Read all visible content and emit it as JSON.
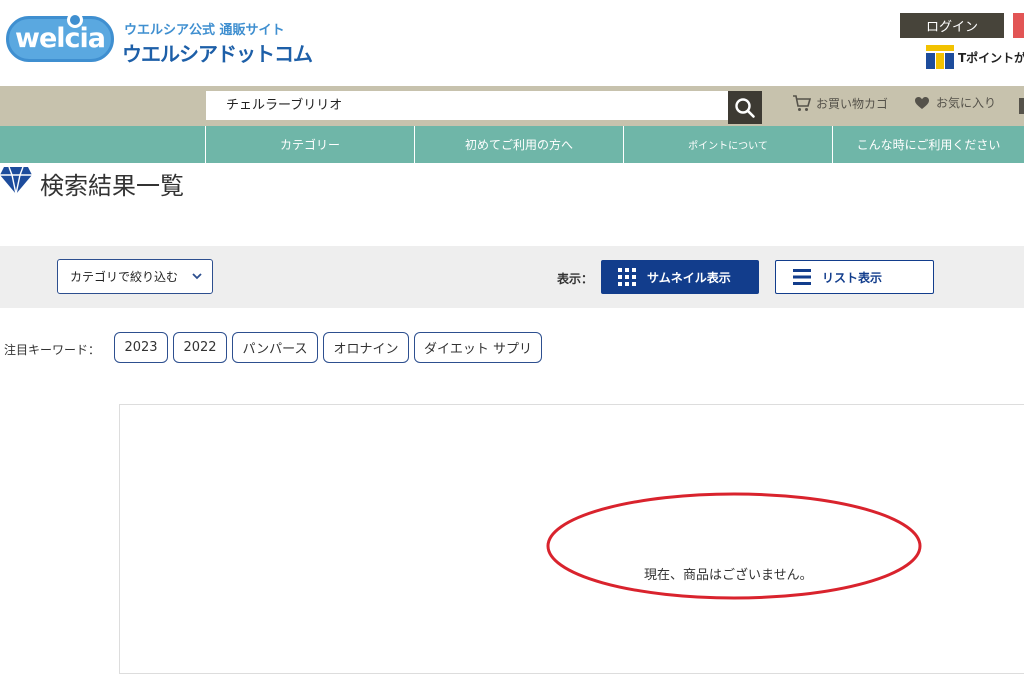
{
  "header": {
    "logo_wordmark": "welcia",
    "logo_subtitle": "ウエルシア公式 通販サイト",
    "logo_title": "ウエルシアドットコム",
    "login_label": "ログイン",
    "tpoint_label": "Tポイントが"
  },
  "search": {
    "value": "チェルラーブリリオ",
    "cart_label": "お買い物カゴ",
    "favorites_label": "お気に入り"
  },
  "nav": {
    "items": [
      {
        "label": "カテゴリー"
      },
      {
        "label": "初めてご利用の方へ"
      },
      {
        "label": "ポイントについて"
      },
      {
        "label": "こんな時にご利用ください"
      }
    ]
  },
  "page": {
    "title": "検索結果一覧"
  },
  "filter": {
    "category_label": "カテゴリで絞り込む",
    "view_label": "表示：",
    "thumbnail_label": "サムネイル表示",
    "list_label": "リスト表示"
  },
  "keywords": {
    "label": "注目キーワード：",
    "items": [
      "2023",
      "2022",
      "パンパース",
      "オロナイン",
      "ダイエット サプリ"
    ]
  },
  "results": {
    "empty_message": "現在、商品はございません。"
  },
  "colors": {
    "nav": "#6fb6a8",
    "search_bar": "#c7c2ad",
    "primary_button": "#123d8c",
    "highlight_ellipse": "#d9232d",
    "logo_blue": "#3f8fd0"
  }
}
